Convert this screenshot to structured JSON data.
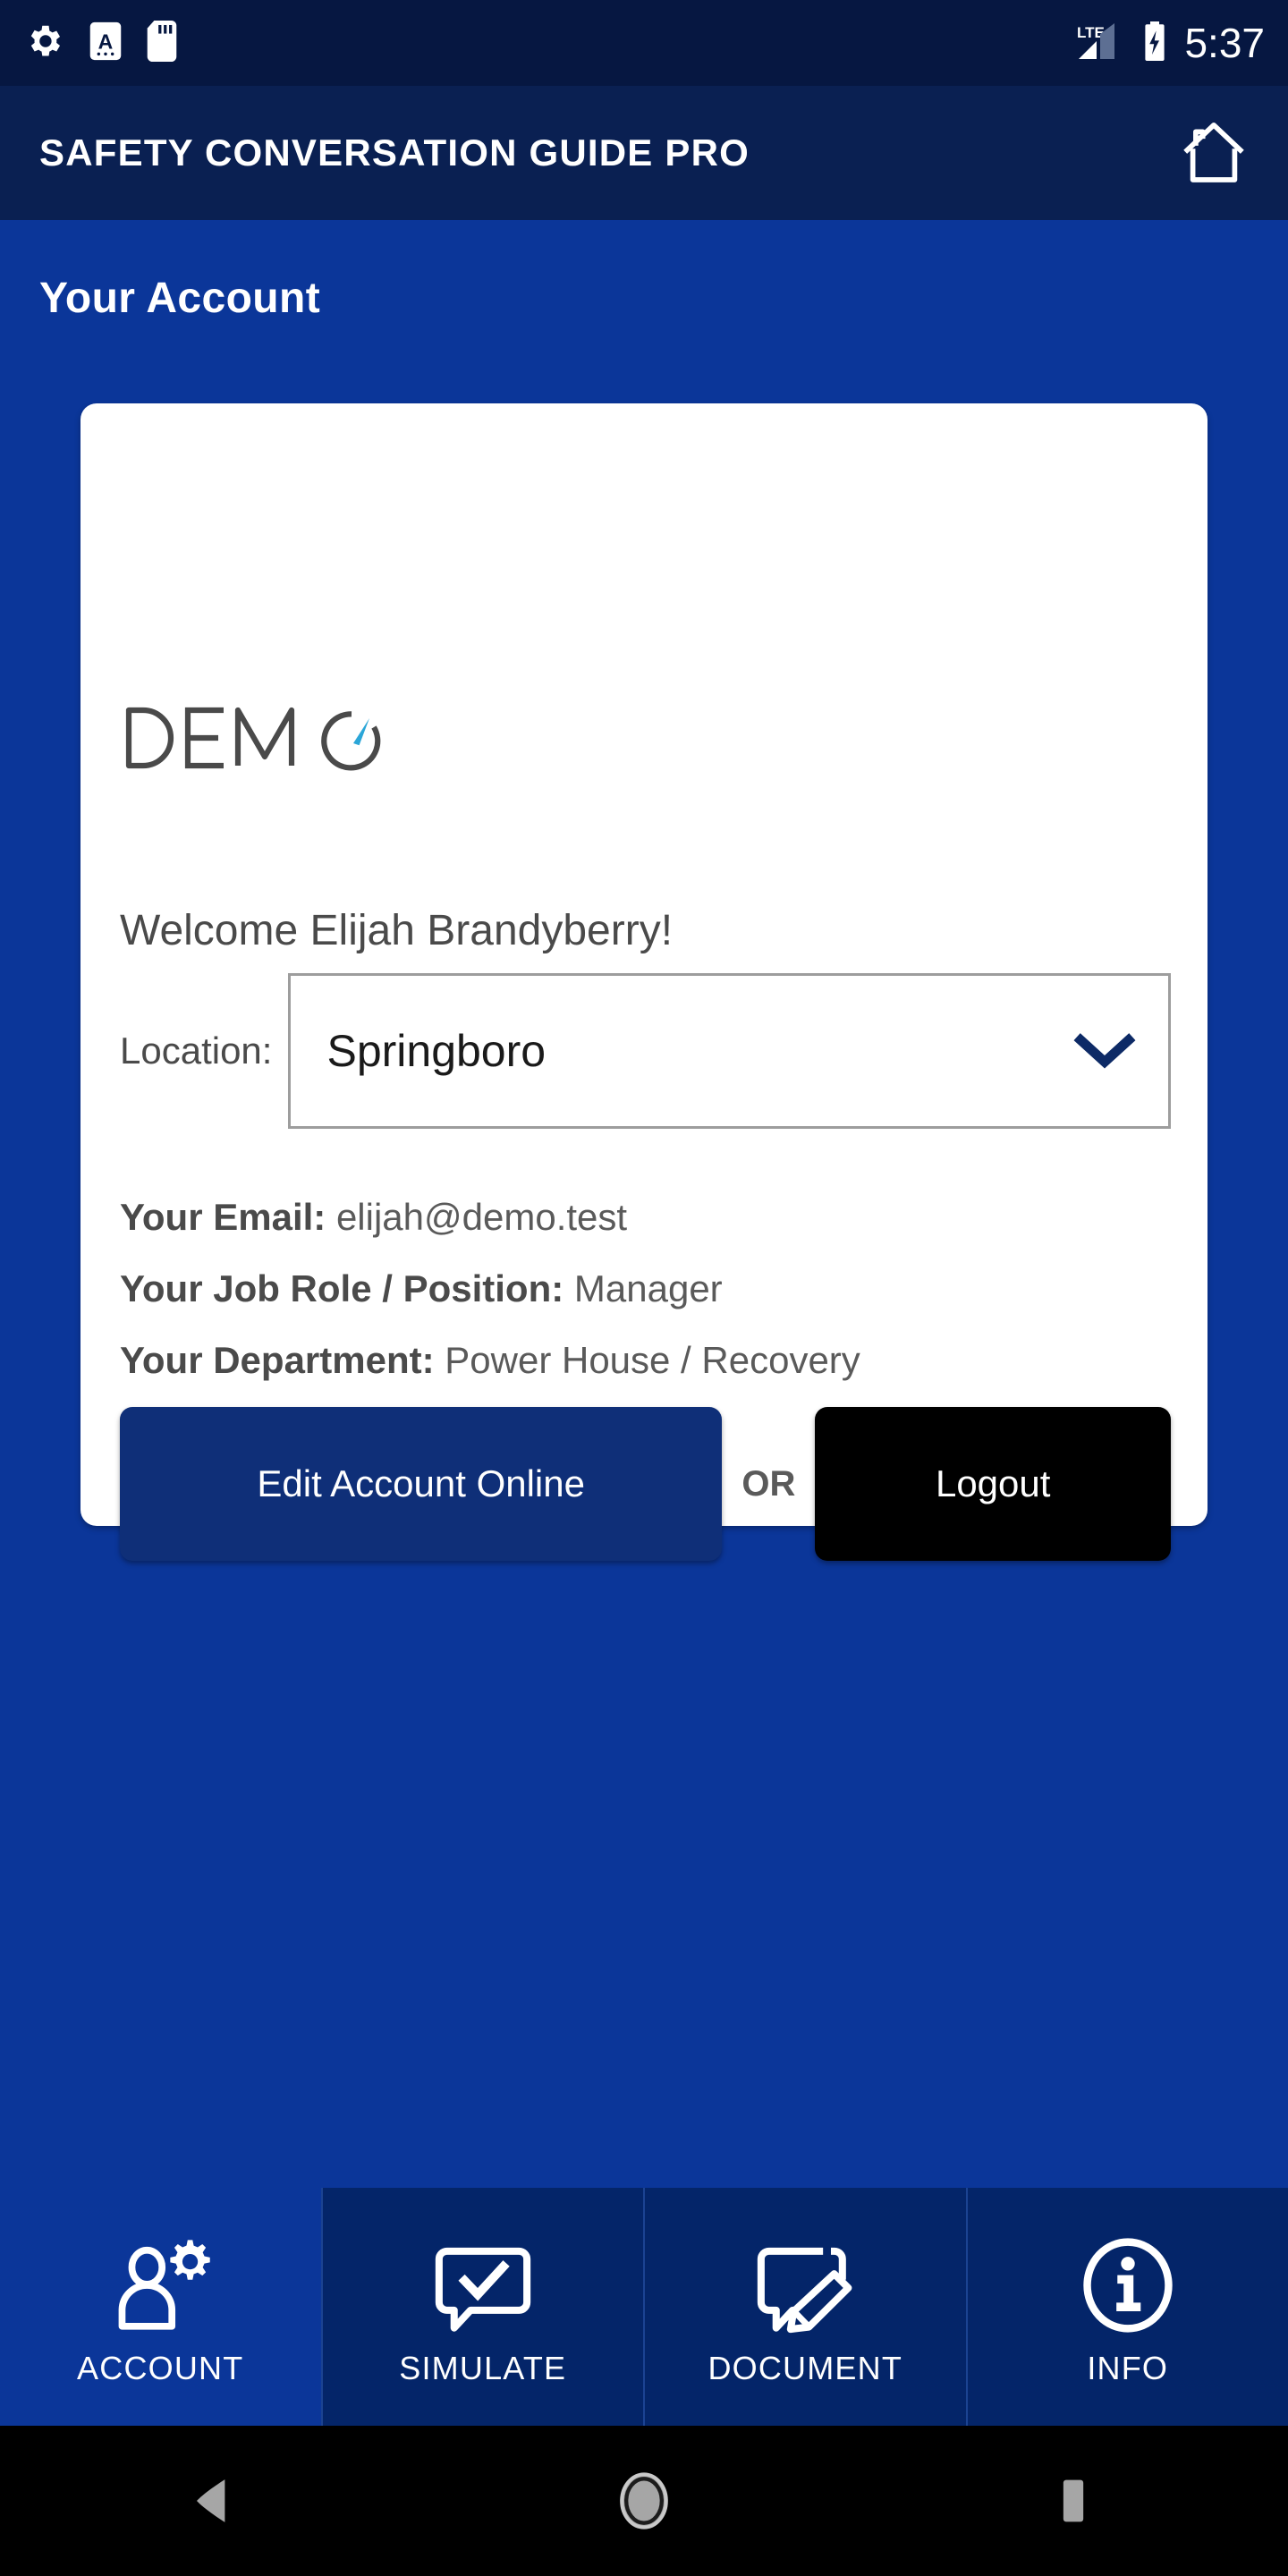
{
  "status_bar": {
    "icons": [
      "settings-gear-icon",
      "capital-a-badge-icon",
      "sd-card-icon"
    ],
    "network": "LTE",
    "battery": "charging",
    "time": "5:37"
  },
  "app_bar": {
    "title": "SAFETY CONVERSATION GUIDE PRO",
    "home_icon": "home-icon"
  },
  "page": {
    "title": "Your Account"
  },
  "card": {
    "logo_text": "DEMO",
    "welcome": "Welcome Elijah Brandyberry!",
    "location_label": "Location:",
    "location_value": "Springboro",
    "location_options": [
      "Springboro"
    ],
    "details": [
      {
        "label": "Your Email:",
        "value": "elijah@demo.test"
      },
      {
        "label": "Your Job Role / Position:",
        "value": "Manager"
      },
      {
        "label": "Your Department:",
        "value": "Power House / Recovery"
      }
    ],
    "primary_button": "Edit Account Online",
    "separator": "OR",
    "secondary_button": "Logout"
  },
  "bottom_nav": {
    "tabs": [
      {
        "label": "ACCOUNT",
        "icon": "user-gear-icon",
        "active": true
      },
      {
        "label": "SIMULATE",
        "icon": "chat-check-icon",
        "active": false
      },
      {
        "label": "DOCUMENT",
        "icon": "chat-pencil-icon",
        "active": false
      },
      {
        "label": "INFO",
        "icon": "info-circle-icon",
        "active": false
      }
    ]
  },
  "android_nav": {
    "back": "back-triangle-icon",
    "home": "home-circle-icon",
    "recents": "recents-square-icon"
  },
  "colors": {
    "status_bar_bg": "#061741",
    "app_bar_bg": "#0a2052",
    "body_bg": "#0b3699",
    "card_bg": "#ffffff",
    "accent_navy": "#0f2f78",
    "tab_inactive_bg": "#042569",
    "logo_gray": "#4a4a4a",
    "logo_needle_blue": "#2ba6d8"
  }
}
